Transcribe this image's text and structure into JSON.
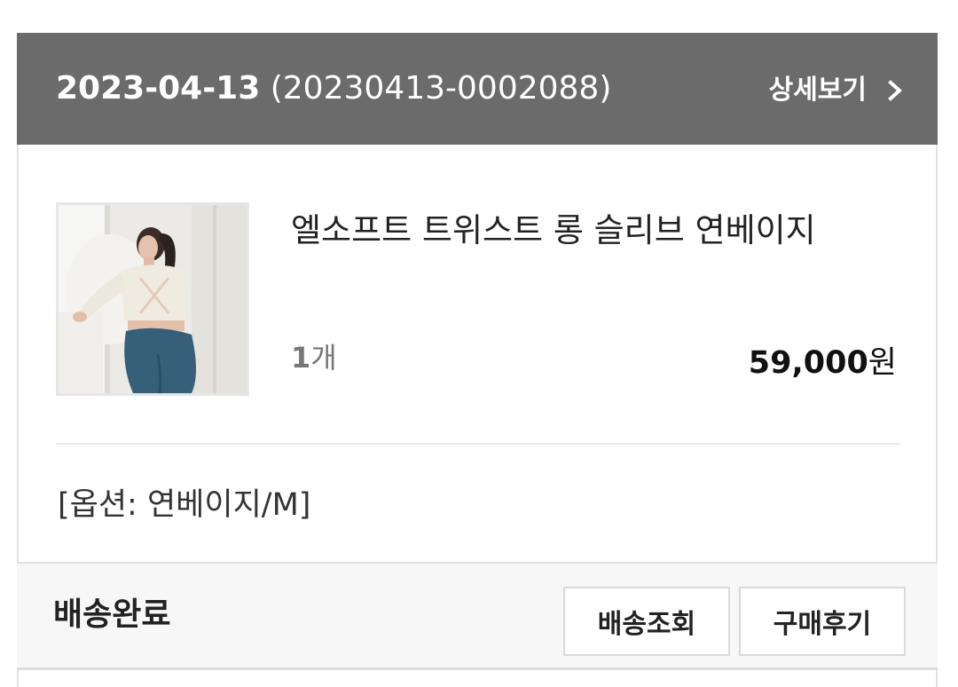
{
  "order": {
    "date": "2023-04-13",
    "order_number": "(20230413-0002088)",
    "detail_link_label": "상세보기"
  },
  "product": {
    "name": "엘소프트 트위스트 롱 슬리브 연베이지",
    "quantity_number": "1",
    "quantity_unit": "개",
    "price_number": "59,000",
    "price_unit": "원",
    "option": "[옵션: 연베이지/M]"
  },
  "status": {
    "label": "배송완료",
    "track_button_label": "배송조회",
    "review_button_label": "구매후기"
  },
  "colors": {
    "header_background": "#6b6b6b",
    "status_background": "#f7f7f7",
    "border": "#e2e2e2"
  },
  "icons": {
    "detail_link": "chevron-right-icon"
  }
}
